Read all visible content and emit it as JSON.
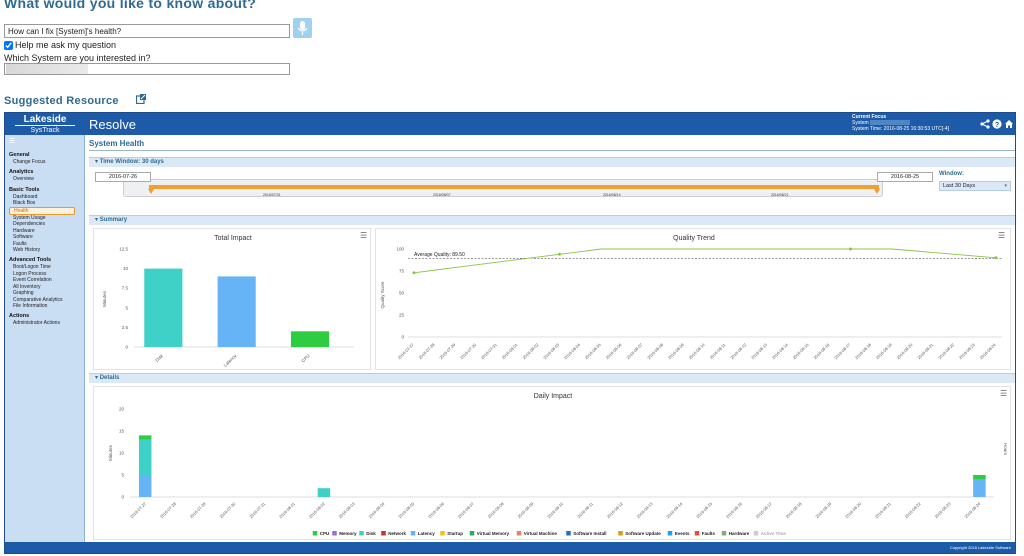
{
  "question": {
    "title": "What would you like to know about?",
    "input_value": "How can I fix [System]'s health?",
    "help_label": "Help me ask my question",
    "help_checked": true,
    "system_label": "Which System are you interested in?",
    "mic_icon": "microphone-icon"
  },
  "resource": {
    "title": "Suggested Resource",
    "icon": "external-link-icon"
  },
  "app": {
    "logo": "Lakeside",
    "logo_sub": "SysTrack",
    "title": "Resolve",
    "focus_label": "Current Focus",
    "system_label": "System",
    "system_time": "System Time: 2016-08-25 16:30:53 UTC[-4]",
    "header_icons": [
      "share-icon",
      "help-icon",
      "home-icon"
    ],
    "footer": "Copyright 2016 Lakeside Software"
  },
  "sidebar": {
    "sections": [
      {
        "heading": "General",
        "items": [
          "Change Focus"
        ]
      },
      {
        "heading": "Analytics",
        "items": [
          "Overview"
        ]
      },
      {
        "heading": "Basic Tools",
        "items": [
          "Dashboard",
          "Black Box",
          "Health",
          "System Usage",
          "Dependencies",
          "Hardware",
          "Software",
          "Faults",
          "Web History"
        ]
      },
      {
        "heading": "Advanced Tools",
        "items": [
          "Boot/Logon Time",
          "Logon Process",
          "Event Correlation",
          "All Inventory",
          "Graphing",
          "Comparative Analytics",
          "File Information"
        ]
      },
      {
        "heading": "Actions",
        "items": [
          "Administrator Actions"
        ]
      }
    ],
    "active_item": "Health"
  },
  "main": {
    "page_title": "System Health",
    "time_window_label": "Time Window: 30 days",
    "start_date": "2016-07-26",
    "end_date": "2016-08-25",
    "timeline_ticks": [
      "2016/07/31",
      "2016/08/07",
      "2016/08/14",
      "2016/08/21"
    ],
    "window_label": "Window:",
    "window_value": "Last 30 Days",
    "summary_label": "Summary",
    "details_label": "Details"
  },
  "chart_data": [
    {
      "type": "bar",
      "title": "Total Impact",
      "ylabel": "Minutes",
      "xlabel": "",
      "categories": [
        "Disk",
        "Latency",
        "CPU"
      ],
      "values": [
        10,
        9,
        2
      ],
      "colors": [
        "#3fd1c8",
        "#66b3f5",
        "#2ecc40"
      ],
      "ylim": [
        0,
        12.5
      ],
      "yticks": [
        0,
        2.5,
        5,
        7.5,
        10,
        12.5
      ],
      "grid": false
    },
    {
      "type": "line",
      "title": "Quality Trend",
      "ylabel": "Quality Score",
      "xlabel": "",
      "x": [
        "2016-07-27",
        "2016-07-28",
        "2016-07-29",
        "2016-07-30",
        "2016-07-31",
        "2016-08-01",
        "2016-08-02",
        "2016-08-03",
        "2016-08-04",
        "2016-08-05",
        "2016-08-06",
        "2016-08-07",
        "2016-08-08",
        "2016-08-09",
        "2016-08-10",
        "2016-08-11",
        "2016-08-12",
        "2016-08-13",
        "2016-08-14",
        "2016-08-15",
        "2016-08-16",
        "2016-08-17",
        "2016-08-18",
        "2016-08-19",
        "2016-08-20",
        "2016-08-21",
        "2016-08-22",
        "2016-08-23",
        "2016-08-24"
      ],
      "series": [
        {
          "values": [
            73,
            76,
            79,
            82,
            85,
            88,
            91,
            94,
            97,
            100,
            100,
            100,
            100,
            100,
            100,
            100,
            100,
            100,
            100,
            100,
            100,
            100,
            100,
            100,
            98,
            96,
            94,
            92,
            90
          ]
        }
      ],
      "markers": [
        0,
        7,
        21,
        28
      ],
      "average_label": "Average Quality: 89.50",
      "average": 89.5,
      "line_color": "#8bc34a",
      "ylim": [
        0,
        100
      ],
      "yticks": [
        0,
        25,
        50,
        75,
        100
      ]
    },
    {
      "type": "bar",
      "title": "Daily Impact",
      "ylabel": "Minutes",
      "y2label": "Hours",
      "xlabel": "",
      "categories": [
        "2016-07-27",
        "2016-07-28",
        "2016-07-29",
        "2016-07-30",
        "2016-07-31",
        "2016-08-01",
        "2016-08-02",
        "2016-08-03",
        "2016-08-04",
        "2016-08-05",
        "2016-08-06",
        "2016-08-07",
        "2016-08-08",
        "2016-08-09",
        "2016-08-10",
        "2016-08-11",
        "2016-08-12",
        "2016-08-13",
        "2016-08-14",
        "2016-08-15",
        "2016-08-16",
        "2016-08-17",
        "2016-08-18",
        "2016-08-19",
        "2016-08-20",
        "2016-08-21",
        "2016-08-22",
        "2016-08-23",
        "2016-08-24"
      ],
      "stacked": true,
      "series": [
        {
          "name": "Latency",
          "color": "#66b3f5",
          "values": [
            5,
            0,
            0,
            0,
            0,
            0,
            0,
            0,
            0,
            0,
            0,
            0,
            0,
            0,
            0,
            0,
            0,
            0,
            0,
            0,
            0,
            0,
            0,
            0,
            0,
            0,
            0,
            0,
            4
          ]
        },
        {
          "name": "Disk",
          "color": "#3fd1c8",
          "values": [
            8,
            0,
            0,
            0,
            0,
            0,
            2,
            0,
            0,
            0,
            0,
            0,
            0,
            0,
            0,
            0,
            0,
            0,
            0,
            0,
            0,
            0,
            0,
            0,
            0,
            0,
            0,
            0,
            0
          ]
        },
        {
          "name": "CPU",
          "color": "#2ecc40",
          "values": [
            1,
            0,
            0,
            0,
            0,
            0,
            0,
            0,
            0,
            0,
            0,
            0,
            0,
            0,
            0,
            0,
            0,
            0,
            0,
            0,
            0,
            0,
            0,
            0,
            0,
            0,
            0,
            0,
            1
          ]
        }
      ],
      "ylim": [
        0,
        20
      ],
      "yticks": [
        0,
        5,
        10,
        15,
        20
      ],
      "legend_position": "bottom",
      "legend": [
        {
          "name": "CPU",
          "color": "#2ecc40"
        },
        {
          "name": "Memory",
          "color": "#9b6bd6"
        },
        {
          "name": "Disk",
          "color": "#3fd1c8"
        },
        {
          "name": "Network",
          "color": "#c0392b"
        },
        {
          "name": "Latency",
          "color": "#66b3f5"
        },
        {
          "name": "Startup",
          "color": "#f1c40f"
        },
        {
          "name": "Virtual Memory",
          "color": "#27ae60"
        },
        {
          "name": "Virtual Machine",
          "color": "#e8806a"
        },
        {
          "name": "Software Install",
          "color": "#2c6fb5"
        },
        {
          "name": "Software Update",
          "color": "#d4a017"
        },
        {
          "name": "Events",
          "color": "#1aa3e8"
        },
        {
          "name": "Faults",
          "color": "#e74c3c"
        },
        {
          "name": "Hardware",
          "color": "#7fae70"
        },
        {
          "name": "Active Time",
          "color": "#cccccc"
        }
      ]
    }
  ]
}
